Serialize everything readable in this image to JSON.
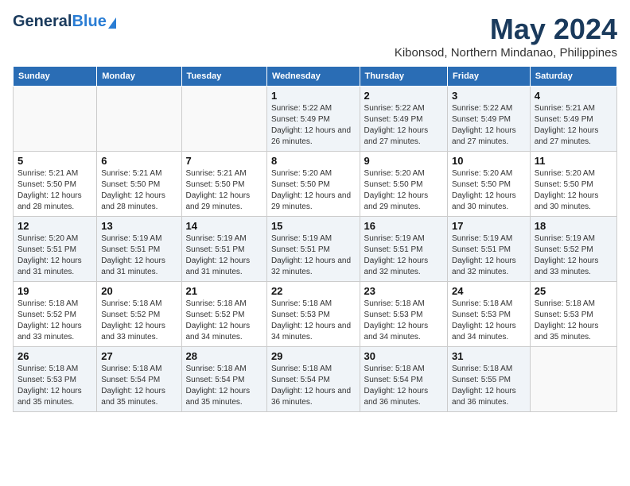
{
  "header": {
    "logo_general": "General",
    "logo_blue": "Blue",
    "month": "May 2024",
    "location": "Kibonsod, Northern Mindanao, Philippines"
  },
  "weekdays": [
    "Sunday",
    "Monday",
    "Tuesday",
    "Wednesday",
    "Thursday",
    "Friday",
    "Saturday"
  ],
  "weeks": [
    [
      {
        "day": "",
        "sunrise": "",
        "sunset": "",
        "daylight": ""
      },
      {
        "day": "",
        "sunrise": "",
        "sunset": "",
        "daylight": ""
      },
      {
        "day": "",
        "sunrise": "",
        "sunset": "",
        "daylight": ""
      },
      {
        "day": "1",
        "sunrise": "Sunrise: 5:22 AM",
        "sunset": "Sunset: 5:49 PM",
        "daylight": "Daylight: 12 hours and 26 minutes."
      },
      {
        "day": "2",
        "sunrise": "Sunrise: 5:22 AM",
        "sunset": "Sunset: 5:49 PM",
        "daylight": "Daylight: 12 hours and 27 minutes."
      },
      {
        "day": "3",
        "sunrise": "Sunrise: 5:22 AM",
        "sunset": "Sunset: 5:49 PM",
        "daylight": "Daylight: 12 hours and 27 minutes."
      },
      {
        "day": "4",
        "sunrise": "Sunrise: 5:21 AM",
        "sunset": "Sunset: 5:49 PM",
        "daylight": "Daylight: 12 hours and 27 minutes."
      }
    ],
    [
      {
        "day": "5",
        "sunrise": "Sunrise: 5:21 AM",
        "sunset": "Sunset: 5:50 PM",
        "daylight": "Daylight: 12 hours and 28 minutes."
      },
      {
        "day": "6",
        "sunrise": "Sunrise: 5:21 AM",
        "sunset": "Sunset: 5:50 PM",
        "daylight": "Daylight: 12 hours and 28 minutes."
      },
      {
        "day": "7",
        "sunrise": "Sunrise: 5:21 AM",
        "sunset": "Sunset: 5:50 PM",
        "daylight": "Daylight: 12 hours and 29 minutes."
      },
      {
        "day": "8",
        "sunrise": "Sunrise: 5:20 AM",
        "sunset": "Sunset: 5:50 PM",
        "daylight": "Daylight: 12 hours and 29 minutes."
      },
      {
        "day": "9",
        "sunrise": "Sunrise: 5:20 AM",
        "sunset": "Sunset: 5:50 PM",
        "daylight": "Daylight: 12 hours and 29 minutes."
      },
      {
        "day": "10",
        "sunrise": "Sunrise: 5:20 AM",
        "sunset": "Sunset: 5:50 PM",
        "daylight": "Daylight: 12 hours and 30 minutes."
      },
      {
        "day": "11",
        "sunrise": "Sunrise: 5:20 AM",
        "sunset": "Sunset: 5:50 PM",
        "daylight": "Daylight: 12 hours and 30 minutes."
      }
    ],
    [
      {
        "day": "12",
        "sunrise": "Sunrise: 5:20 AM",
        "sunset": "Sunset: 5:51 PM",
        "daylight": "Daylight: 12 hours and 31 minutes."
      },
      {
        "day": "13",
        "sunrise": "Sunrise: 5:19 AM",
        "sunset": "Sunset: 5:51 PM",
        "daylight": "Daylight: 12 hours and 31 minutes."
      },
      {
        "day": "14",
        "sunrise": "Sunrise: 5:19 AM",
        "sunset": "Sunset: 5:51 PM",
        "daylight": "Daylight: 12 hours and 31 minutes."
      },
      {
        "day": "15",
        "sunrise": "Sunrise: 5:19 AM",
        "sunset": "Sunset: 5:51 PM",
        "daylight": "Daylight: 12 hours and 32 minutes."
      },
      {
        "day": "16",
        "sunrise": "Sunrise: 5:19 AM",
        "sunset": "Sunset: 5:51 PM",
        "daylight": "Daylight: 12 hours and 32 minutes."
      },
      {
        "day": "17",
        "sunrise": "Sunrise: 5:19 AM",
        "sunset": "Sunset: 5:51 PM",
        "daylight": "Daylight: 12 hours and 32 minutes."
      },
      {
        "day": "18",
        "sunrise": "Sunrise: 5:19 AM",
        "sunset": "Sunset: 5:52 PM",
        "daylight": "Daylight: 12 hours and 33 minutes."
      }
    ],
    [
      {
        "day": "19",
        "sunrise": "Sunrise: 5:18 AM",
        "sunset": "Sunset: 5:52 PM",
        "daylight": "Daylight: 12 hours and 33 minutes."
      },
      {
        "day": "20",
        "sunrise": "Sunrise: 5:18 AM",
        "sunset": "Sunset: 5:52 PM",
        "daylight": "Daylight: 12 hours and 33 minutes."
      },
      {
        "day": "21",
        "sunrise": "Sunrise: 5:18 AM",
        "sunset": "Sunset: 5:52 PM",
        "daylight": "Daylight: 12 hours and 34 minutes."
      },
      {
        "day": "22",
        "sunrise": "Sunrise: 5:18 AM",
        "sunset": "Sunset: 5:53 PM",
        "daylight": "Daylight: 12 hours and 34 minutes."
      },
      {
        "day": "23",
        "sunrise": "Sunrise: 5:18 AM",
        "sunset": "Sunset: 5:53 PM",
        "daylight": "Daylight: 12 hours and 34 minutes."
      },
      {
        "day": "24",
        "sunrise": "Sunrise: 5:18 AM",
        "sunset": "Sunset: 5:53 PM",
        "daylight": "Daylight: 12 hours and 34 minutes."
      },
      {
        "day": "25",
        "sunrise": "Sunrise: 5:18 AM",
        "sunset": "Sunset: 5:53 PM",
        "daylight": "Daylight: 12 hours and 35 minutes."
      }
    ],
    [
      {
        "day": "26",
        "sunrise": "Sunrise: 5:18 AM",
        "sunset": "Sunset: 5:53 PM",
        "daylight": "Daylight: 12 hours and 35 minutes."
      },
      {
        "day": "27",
        "sunrise": "Sunrise: 5:18 AM",
        "sunset": "Sunset: 5:54 PM",
        "daylight": "Daylight: 12 hours and 35 minutes."
      },
      {
        "day": "28",
        "sunrise": "Sunrise: 5:18 AM",
        "sunset": "Sunset: 5:54 PM",
        "daylight": "Daylight: 12 hours and 35 minutes."
      },
      {
        "day": "29",
        "sunrise": "Sunrise: 5:18 AM",
        "sunset": "Sunset: 5:54 PM",
        "daylight": "Daylight: 12 hours and 36 minutes."
      },
      {
        "day": "30",
        "sunrise": "Sunrise: 5:18 AM",
        "sunset": "Sunset: 5:54 PM",
        "daylight": "Daylight: 12 hours and 36 minutes."
      },
      {
        "day": "31",
        "sunrise": "Sunrise: 5:18 AM",
        "sunset": "Sunset: 5:55 PM",
        "daylight": "Daylight: 12 hours and 36 minutes."
      },
      {
        "day": "",
        "sunrise": "",
        "sunset": "",
        "daylight": ""
      }
    ]
  ]
}
